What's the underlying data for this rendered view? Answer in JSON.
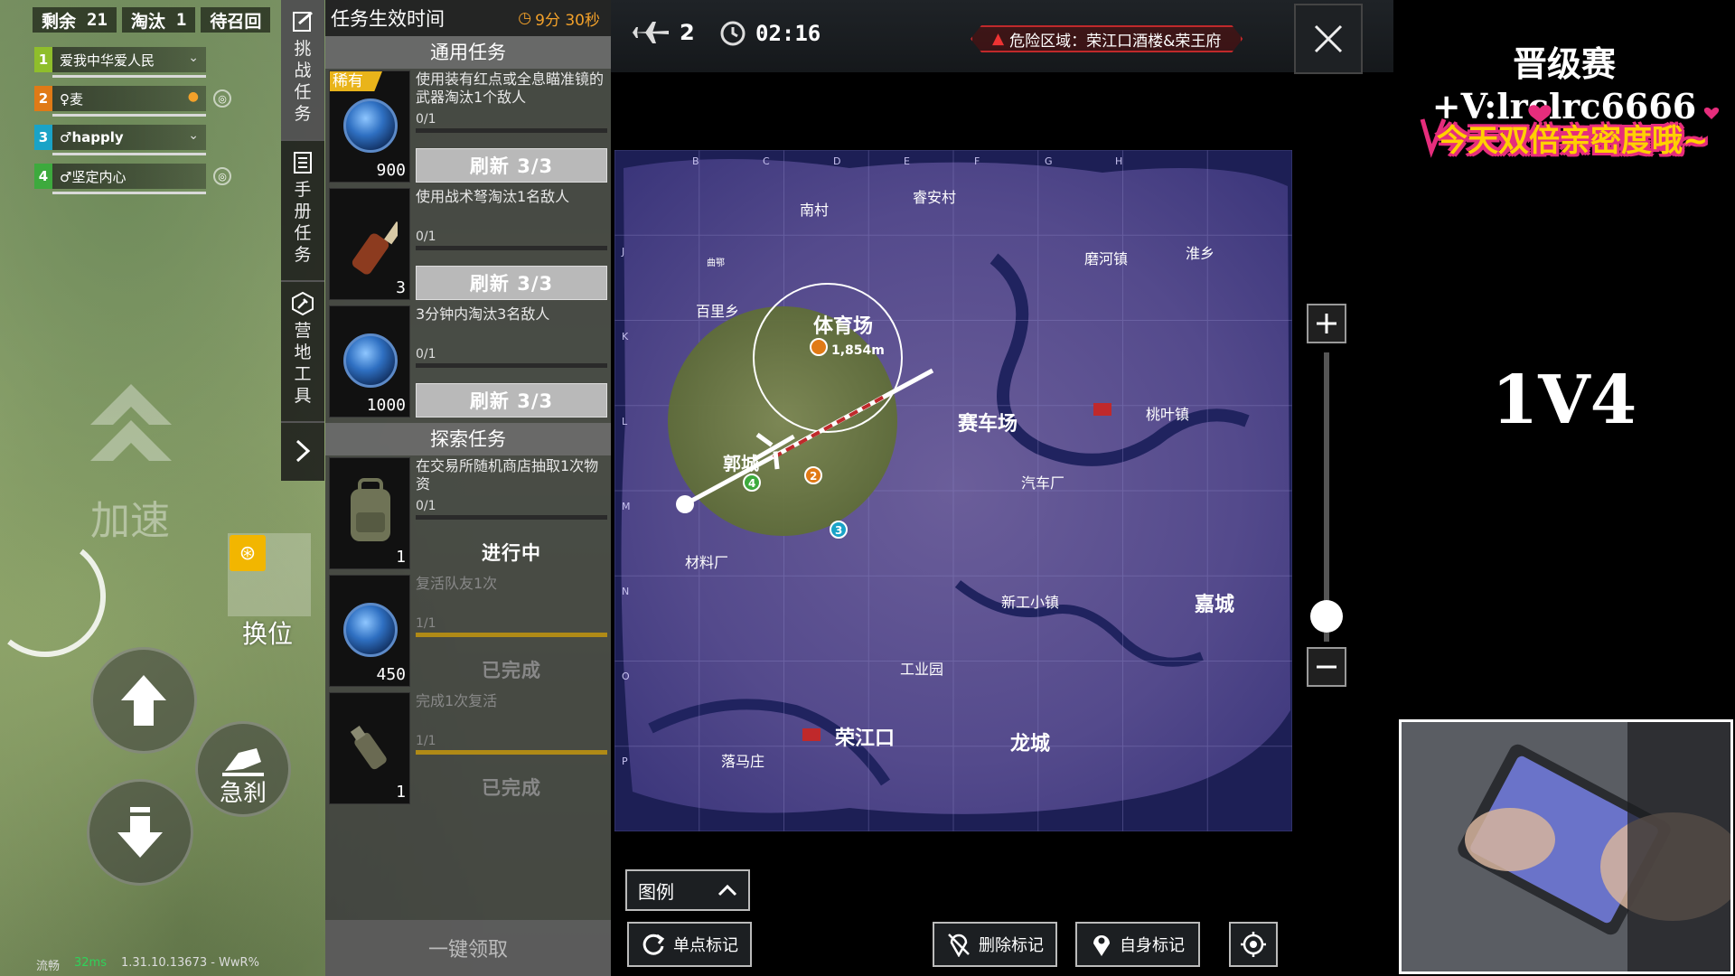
{
  "hud": {
    "alive_label": "剩余",
    "alive_count": "21",
    "elim_label": "淘汰",
    "elim_count": "1",
    "recall_label": "待召回"
  },
  "team": [
    {
      "index": "1",
      "name": "爱我中华爱人民",
      "color": "#8fbe2b"
    },
    {
      "index": "2",
      "name": "♀麦",
      "color": "#e07a16"
    },
    {
      "index": "3",
      "name": "♂happly",
      "color": "#1aa3c7"
    },
    {
      "index": "4",
      "name": "♂坚定内心",
      "color": "#3daa3d"
    }
  ],
  "controls": {
    "accelerate": "加速",
    "swap_seat": "换位",
    "brake": "急刹",
    "status_left": "流畅",
    "status_ping": "32ms",
    "version": "1.31.10.13673 - WwR%"
  },
  "side_tabs": [
    {
      "label": "挑战任务",
      "icon": "challenge-icon"
    },
    {
      "label": "手册任务",
      "icon": "handbook-icon"
    },
    {
      "label": "营地工具",
      "icon": "wrench-icon"
    }
  ],
  "mission": {
    "title": "任务生效时间",
    "timer": "9分 30秒",
    "general_section": "通用任务",
    "explore_section": "探索任务",
    "claim_all": "一键领取",
    "tasks": [
      {
        "rarity": "稀有",
        "desc": "使用装有红点或全息瞄准镜的武器淘汰1个敌人",
        "progress": "0/1",
        "progress_ratio": 0,
        "reward": "900",
        "button": "刷新 3/3",
        "icon": "coin-icon"
      },
      {
        "rarity": "",
        "desc": "使用战术弩淘汰1名敌人",
        "progress": "0/1",
        "progress_ratio": 0,
        "reward": "3",
        "button": "刷新 3/3",
        "icon": "molotov-icon"
      },
      {
        "rarity": "",
        "desc": "3分钟内淘汰3名敌人",
        "progress": "0/1",
        "progress_ratio": 0,
        "reward": "1000",
        "button": "刷新 3/3",
        "icon": "coin-icon"
      }
    ],
    "explore_tasks": [
      {
        "desc": "在交易所随机商店抽取1次物资",
        "progress": "0/1",
        "progress_ratio": 0,
        "reward": "1",
        "button": "进行中",
        "icon": "backpack-icon"
      },
      {
        "desc": "复活队友1次",
        "progress": "1/1",
        "progress_ratio": 1,
        "reward": "450",
        "button": "已完成",
        "icon": "coin-icon"
      },
      {
        "desc": "完成1次复活",
        "progress": "1/1",
        "progress_ratio": 1,
        "reward": "1",
        "button": "已完成",
        "icon": "grenade-icon"
      }
    ]
  },
  "map": {
    "plane_count": "2",
    "time": "02:16",
    "danger": "危险区域：荣江口酒楼&荣王府",
    "distance": "1,854m",
    "legend": "图例",
    "single_mark": "单点标记",
    "delete_mark": "删除标记",
    "self_mark": "自身标记",
    "grid_cols": [
      "B",
      "C",
      "D",
      "E",
      "F",
      "G",
      "H"
    ],
    "grid_rows": [
      "J",
      "K",
      "L",
      "M",
      "N",
      "O",
      "P"
    ],
    "places": [
      {
        "name": "南村"
      },
      {
        "name": "睿安村"
      },
      {
        "name": "磨河镇"
      },
      {
        "name": "淮乡"
      },
      {
        "name": "百里乡"
      },
      {
        "name": "体育场"
      },
      {
        "name": "赛车场"
      },
      {
        "name": "桃叶镇"
      },
      {
        "name": "郭城"
      },
      {
        "name": "汽车厂"
      },
      {
        "name": "材料厂"
      },
      {
        "name": "新工小镇"
      },
      {
        "name": "嘉城"
      },
      {
        "name": "工业园"
      },
      {
        "name": "荣江口"
      },
      {
        "name": "龙城"
      },
      {
        "name": "落马庄"
      },
      {
        "name": "曲鄂"
      }
    ]
  },
  "overlay": {
    "promo": "晋级赛+V:lrclrc6666",
    "banner": "今天双倍亲密度哦~",
    "match": "1V4"
  }
}
